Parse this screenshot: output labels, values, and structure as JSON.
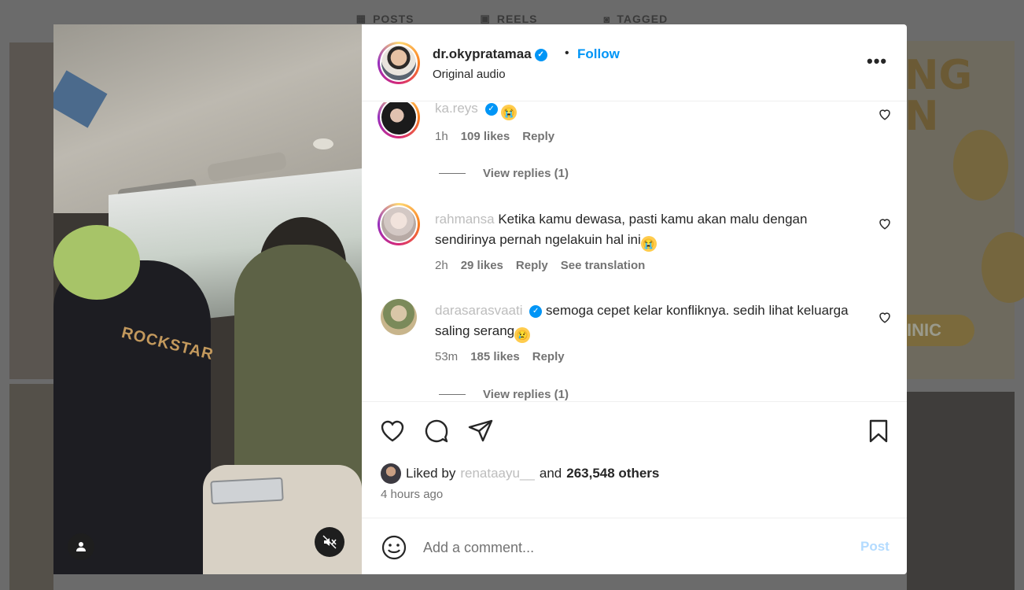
{
  "profile_tabs": [
    {
      "label": "POSTS",
      "icon": "grid-icon"
    },
    {
      "label": "REELS",
      "icon": "reels-icon"
    },
    {
      "label": "TAGGED",
      "icon": "tagged-icon"
    }
  ],
  "background": {
    "right_text": "NG\nN",
    "right_pill": "INIC"
  },
  "media": {
    "shirt_print": "ROCKSTAR",
    "tag_icon": "person-tag-icon",
    "mute_icon": "speaker-muted-icon"
  },
  "post": {
    "username": "dr.okypratamaa",
    "verified": true,
    "separator": "•",
    "follow_label": "Follow",
    "audio": "Original audio",
    "more_label": "•••"
  },
  "comments": [
    {
      "user": "ka.reys",
      "verified": true,
      "text": "",
      "emoji": "😭",
      "time": "1h",
      "likes": "109 likes",
      "reply": "Reply",
      "view_replies": "View replies (1)"
    },
    {
      "user": "rahmansa",
      "verified": false,
      "text": "Ketika kamu dewasa, pasti kamu akan malu dengan sendirinya pernah ngelakuin hal ini",
      "emoji": "😭",
      "time": "2h",
      "likes": "29 likes",
      "reply": "Reply",
      "translation": "See translation"
    },
    {
      "user": "darasarasvaati",
      "verified": true,
      "text": "semoga cepet kelar konfliknya. sedih lihat keluarga saling serang",
      "emoji": "😢",
      "time": "53m",
      "likes": "185 likes",
      "reply": "Reply",
      "view_replies": "View replies (1)"
    }
  ],
  "likes": {
    "prefix": "Liked by",
    "liker": "renataayu__",
    "and": "and",
    "count": "263,548 others"
  },
  "time_ago": "4 hours ago",
  "comment_input": {
    "placeholder": "Add a comment...",
    "post_label": "Post"
  },
  "colors": {
    "accent": "#0095f6",
    "post_disabled": "#b3dbff",
    "muted": "#737373"
  }
}
